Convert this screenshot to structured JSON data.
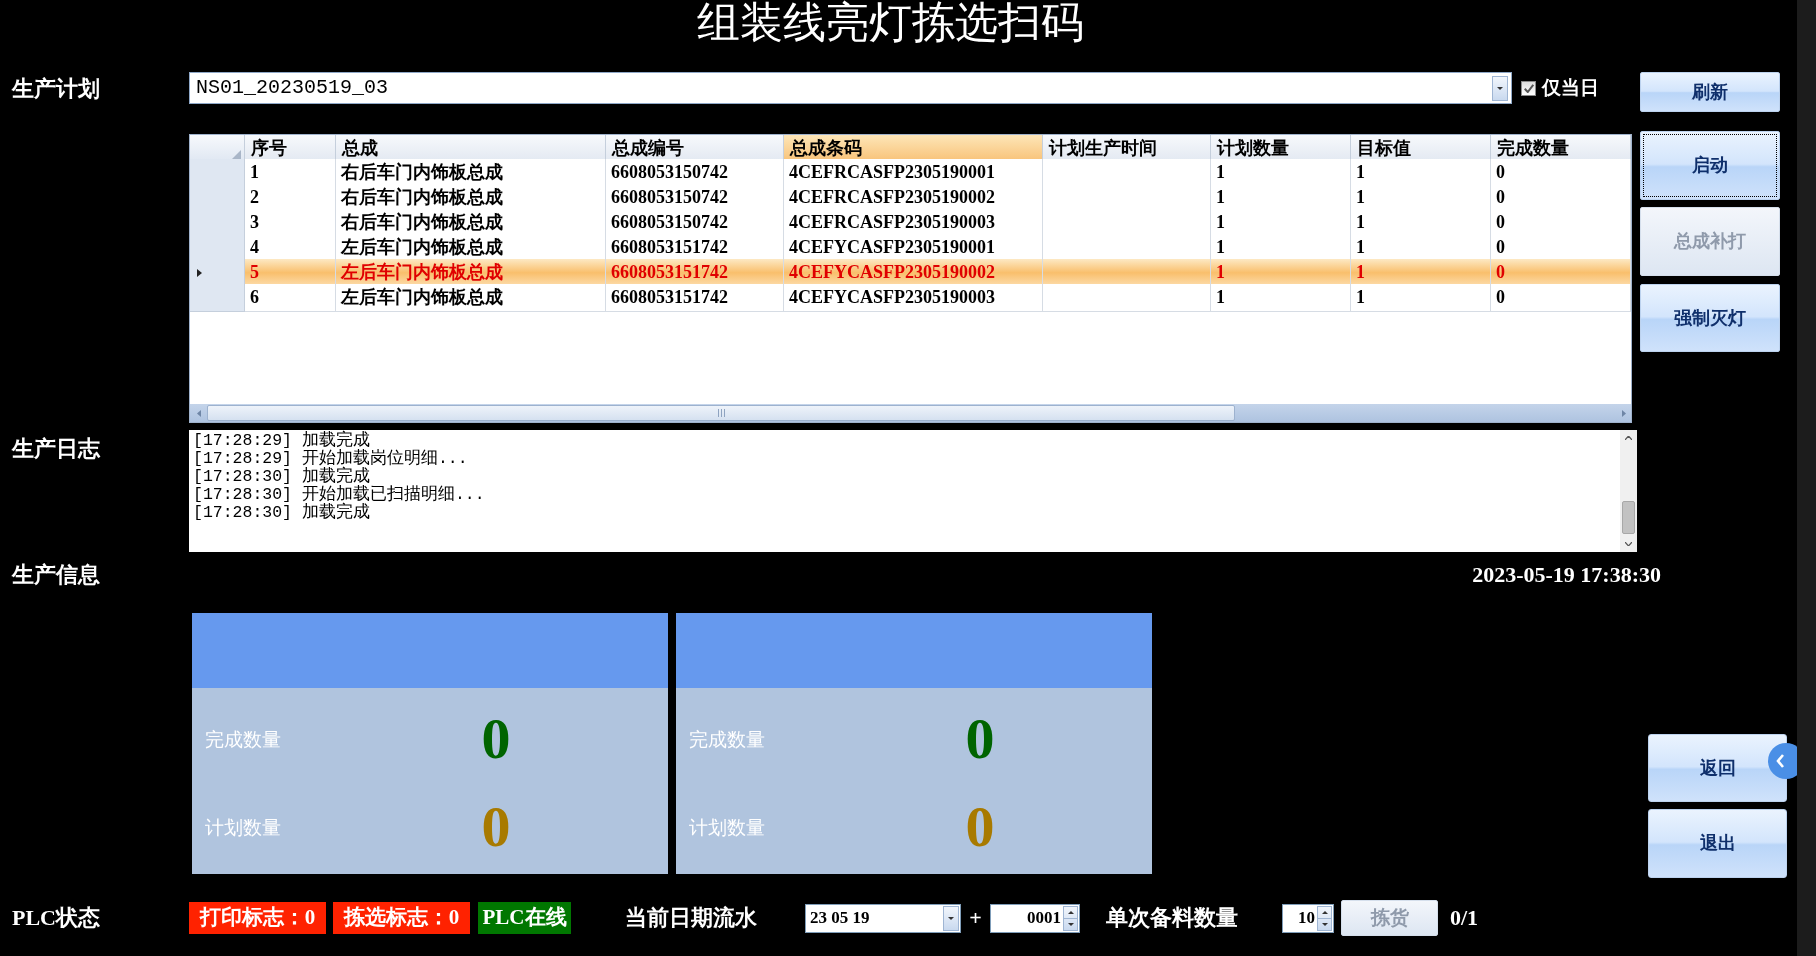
{
  "window": {
    "title": "组装线亮灯拣选扫码"
  },
  "plan": {
    "label": "生产计划",
    "value": "NS01_20230519_03",
    "today_only": {
      "label": "仅当日",
      "checked": true
    }
  },
  "table": {
    "columns": [
      {
        "label": "序号",
        "selected": false
      },
      {
        "label": "总成",
        "selected": false
      },
      {
        "label": "总成编号",
        "selected": false
      },
      {
        "label": "总成条码",
        "selected": true
      },
      {
        "label": "计划生产时间",
        "selected": false
      },
      {
        "label": "计划数量",
        "selected": false
      },
      {
        "label": "目标值",
        "selected": false
      },
      {
        "label": "完成数量",
        "selected": false
      }
    ],
    "rows": [
      {
        "no": "1",
        "assembly": "右后车门内饰板总成",
        "part_no": "6608053150742",
        "barcode": "4CEFRCASFP2305190001",
        "plan_qty": "1",
        "target": "1",
        "done": "0",
        "selected": false
      },
      {
        "no": "2",
        "assembly": "右后车门内饰板总成",
        "part_no": "6608053150742",
        "barcode": "4CEFRCASFP2305190002",
        "plan_qty": "1",
        "target": "1",
        "done": "0",
        "selected": false
      },
      {
        "no": "3",
        "assembly": "右后车门内饰板总成",
        "part_no": "6608053150742",
        "barcode": "4CEFRCASFP2305190003",
        "plan_qty": "1",
        "target": "1",
        "done": "0",
        "selected": false
      },
      {
        "no": "4",
        "assembly": "左后车门内饰板总成",
        "part_no": "6608053151742",
        "barcode": "4CEFYCASFP2305190001",
        "plan_qty": "1",
        "target": "1",
        "done": "0",
        "selected": false
      },
      {
        "no": "5",
        "assembly": "左后车门内饰板总成",
        "part_no": "6608053151742",
        "barcode": "4CEFYCASFP2305190002",
        "plan_qty": "1",
        "target": "1",
        "done": "0",
        "selected": true
      },
      {
        "no": "6",
        "assembly": "左后车门内饰板总成",
        "part_no": "6608053151742",
        "barcode": "4CEFYCASFP2305190003",
        "plan_qty": "1",
        "target": "1",
        "done": "0",
        "selected": false
      }
    ]
  },
  "side_buttons": [
    {
      "label": "刷新",
      "disabled": false,
      "focused": false
    },
    {
      "label": "启动",
      "disabled": false,
      "focused": true
    },
    {
      "label": "总成补打",
      "disabled": true,
      "focused": false
    },
    {
      "label": "强制灭灯",
      "disabled": false,
      "focused": false
    }
  ],
  "log": {
    "label": "生产日志",
    "lines": [
      "[17:28:29] 加载完成",
      "[17:28:29] 开始加载岗位明细...",
      "[17:28:30] 加载完成",
      "[17:28:30] 开始加载已扫描明细...",
      "[17:28:30] 加载完成"
    ]
  },
  "info": {
    "label": "生产信息",
    "datetime": "2023-05-19 17:38:30",
    "panels": [
      {
        "rows": [
          {
            "label": "完成数量",
            "value": "0",
            "color": "#006400"
          },
          {
            "label": "计划数量",
            "value": "0",
            "color": "#a87a00"
          }
        ]
      },
      {
        "rows": [
          {
            "label": "完成数量",
            "value": "0",
            "color": "#006400"
          },
          {
            "label": "计划数量",
            "value": "0",
            "color": "#a87a00"
          }
        ]
      }
    ]
  },
  "nav_buttons": [
    {
      "label": "返回"
    },
    {
      "label": "退出"
    }
  ],
  "plc": {
    "label": "PLC状态",
    "flags": [
      {
        "label": "打印标志：0",
        "color": "#ff2200"
      },
      {
        "label": "拣选标志：0",
        "color": "#ff2200"
      },
      {
        "label": "PLC在线",
        "color": "#007700"
      }
    ]
  },
  "serial": {
    "label": "当前日期流水",
    "date": "23 05 19",
    "plus": "+",
    "number": "0001"
  },
  "batch": {
    "label": "单次备料数量",
    "value": "10",
    "pick_button": {
      "label": "拣货",
      "disabled": true
    },
    "progress": "0/1"
  }
}
